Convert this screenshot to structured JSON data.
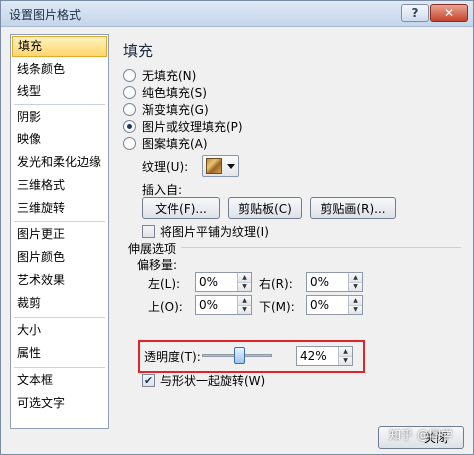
{
  "window": {
    "title": "设置图片格式",
    "help": "?",
    "close": "✕"
  },
  "sidebar": {
    "items": [
      {
        "label": "填充"
      },
      {
        "label": "线条颜色"
      },
      {
        "label": "线型"
      },
      {
        "label": "阴影"
      },
      {
        "label": "映像"
      },
      {
        "label": "发光和柔化边缘"
      },
      {
        "label": "三维格式"
      },
      {
        "label": "三维旋转"
      },
      {
        "label": "图片更正"
      },
      {
        "label": "图片颜色"
      },
      {
        "label": "艺术效果"
      },
      {
        "label": "裁剪"
      },
      {
        "label": "大小"
      },
      {
        "label": "属性"
      },
      {
        "label": "文本框"
      },
      {
        "label": "可选文字"
      }
    ]
  },
  "fill": {
    "heading": "填充",
    "options": [
      {
        "label": "无填充(N)"
      },
      {
        "label": "纯色填充(S)"
      },
      {
        "label": "渐变填充(G)"
      },
      {
        "label": "图片或纹理填充(P)"
      },
      {
        "label": "图案填充(A)"
      }
    ],
    "texture_label": "纹理(U):",
    "insert_from": "插入自:",
    "buttons": {
      "file": "文件(F)...",
      "clipboard": "剪贴板(C)",
      "clipart": "剪贴画(R)..."
    },
    "tile_label": "将图片平铺为纹理(I)",
    "stretch_label": "伸展选项",
    "offset_label": "偏移量:",
    "offsets": {
      "left_label": "左(L):",
      "left_value": "0%",
      "right_label": "右(R):",
      "right_value": "0%",
      "top_label": "上(O):",
      "top_value": "0%",
      "bottom_label": "下(M):",
      "bottom_value": "0%"
    },
    "transparency_label": "透明度(T):",
    "transparency_value": "42%",
    "transparency_level": 0.42,
    "rotate_label": "与形状一起旋转(W)"
  },
  "footer": {
    "close": "关闭",
    "watermark": "知乎 @同学"
  }
}
